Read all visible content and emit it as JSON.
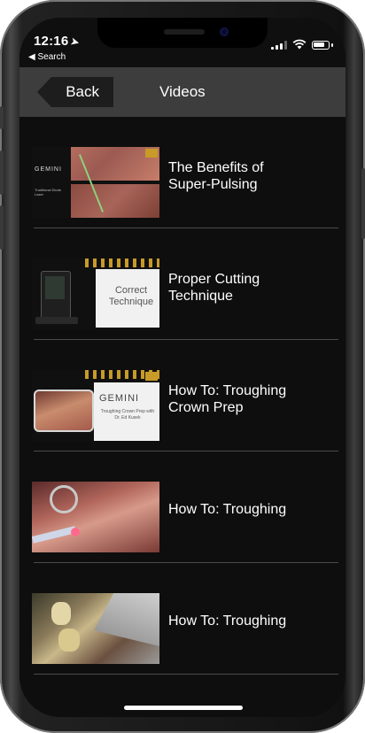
{
  "status_bar": {
    "time": "12:16",
    "back_to_app": "Search"
  },
  "navbar": {
    "back_label": "Back",
    "title": "Videos"
  },
  "videos": [
    {
      "title_line1": "The Benefits of",
      "title_line2": "Super-Pulsing",
      "thumb_text": "GEMINI",
      "thumb_subtext": "Traditional Diode Laser"
    },
    {
      "title_line1": "Proper Cutting",
      "title_line2": "Technique",
      "thumb_text": "Correct Technique"
    },
    {
      "title_line1": "How To: Troughing",
      "title_line2": "Crown Prep",
      "thumb_text": "GEMINI",
      "thumb_subtext": "Troughing Crown Prep with Dr. Ed Kusek"
    },
    {
      "title_line1": "How To: Troughing",
      "title_line2": ""
    },
    {
      "title_line1": "How To: Troughing",
      "title_line2": ""
    }
  ],
  "colors": {
    "background": "#0e0e0e",
    "navbar": "#3d3d3d",
    "back_button": "#1d1d1d",
    "accent_gold": "#c89a28"
  }
}
